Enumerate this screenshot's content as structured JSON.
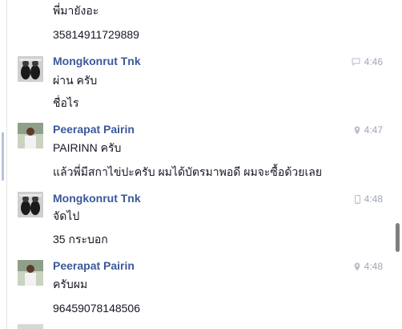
{
  "messages": {
    "m0_line1": "พี่มายังอะ",
    "m0_line2": "35814911729889",
    "g1": {
      "name": "Mongkonrut Tnk",
      "time": "4:46",
      "icon": "chat-bubble-icon",
      "line1": "ผ่าน ครับ",
      "line2": "ชื่อไร"
    },
    "g2": {
      "name": "Peerapat Pairin",
      "time": "4:47",
      "icon": "location-pin-icon",
      "line1": "PAIRINN ครับ",
      "line2": "แล้วพี่มีสกาไข่ปะครับ ผมได้บัตรมาพอดี ผมจะซื้อด้วยเลย"
    },
    "g3": {
      "name": "Mongkonrut Tnk",
      "time": "4:48",
      "icon": "mobile-phone-icon",
      "line1": "จัดไป",
      "line2": "35 กระบอก"
    },
    "g4": {
      "name": "Peerapat Pairin",
      "time": "4:48",
      "icon": "location-pin-icon",
      "line1": "ครับผม",
      "line2": "96459078148506"
    }
  },
  "colors": {
    "name": "#3b5998",
    "meta": "#a0a7b4",
    "text": "#141823"
  }
}
